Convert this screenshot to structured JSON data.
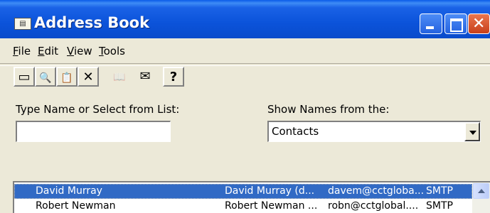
{
  "window": {
    "title": "Address Book",
    "icon": "address-book-icon"
  },
  "menu": [
    {
      "label": "File"
    },
    {
      "label": "Edit"
    },
    {
      "label": "View"
    },
    {
      "label": "Tools"
    }
  ],
  "toolbar": [
    {
      "icon": "new-entry-icon",
      "glyph": "▭",
      "enabled": true
    },
    {
      "icon": "find-people-icon",
      "glyph": "🔍",
      "enabled": true
    },
    {
      "icon": "properties-icon",
      "glyph": "📋",
      "enabled": true
    },
    {
      "icon": "delete-icon",
      "glyph": "✕",
      "enabled": true
    },
    {
      "icon": "address-book-disabled-icon",
      "glyph": "📖",
      "enabled": false
    },
    {
      "icon": "new-message-icon",
      "glyph": "✉",
      "enabled": true
    },
    {
      "icon": "help-icon",
      "glyph": "?",
      "enabled": true
    }
  ],
  "search": {
    "label": "Type Name or Select from List:",
    "value": ""
  },
  "source": {
    "label": "Show Names from the:",
    "value": "Contacts"
  },
  "contacts": [
    {
      "name": "David Murray",
      "display": "David Murray (d...",
      "email": "davem@cctgloba...",
      "type": "SMTP",
      "selected": true
    },
    {
      "name": "Robert Newman",
      "display": "Robert Newman ...",
      "email": "robn@cctglobal....",
      "type": "SMTP",
      "selected": false
    }
  ],
  "colors": {
    "titlebar": "#0A4BCB",
    "selection": "#316AC5",
    "face": "#ECE9D8"
  }
}
